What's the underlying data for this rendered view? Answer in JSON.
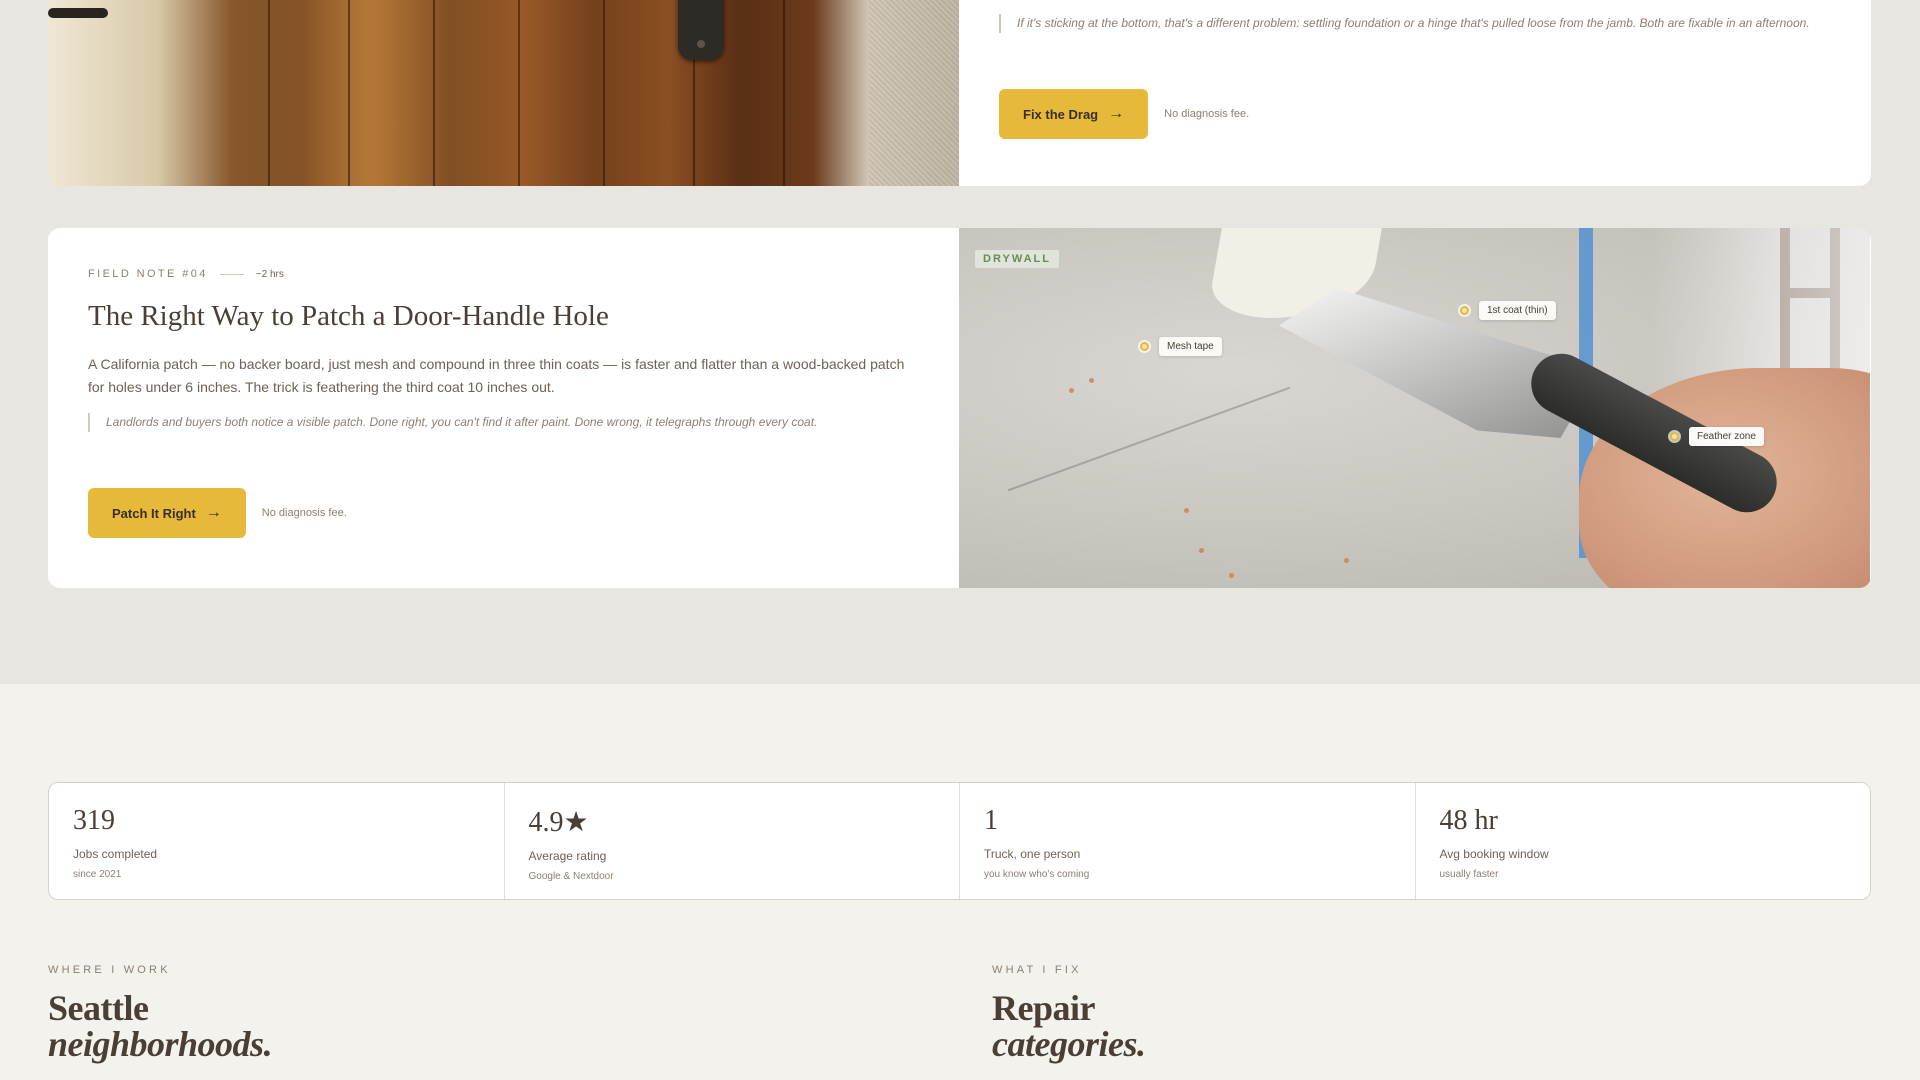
{
  "cards": {
    "drag": {
      "quote": "If it's sticking at the bottom, that's a different problem: settling foundation or a hinge that's pulled loose from the jamb. Both are fixable in an afternoon.",
      "button": "Fix the Drag",
      "note": "No diagnosis fee."
    },
    "patch": {
      "field_note": "FIELD NOTE #04",
      "duration": "~2 hrs",
      "title": "The Right Way to Patch a Door-Handle Hole",
      "body": "A California patch — no backer board, just mesh and compound in three thin coats — is faster and flatter than a wood-backed patch for holes under 6 inches. The trick is feathering the third coat 10 inches out.",
      "quote": "Landlords and buyers both notice a visible patch. Done right, you can't find it after paint. Done wrong, it telegraphs through every coat.",
      "button": "Patch It Right",
      "note": "No diagnosis fee.",
      "image_tag": "DRYWALL",
      "callouts": [
        "Mesh tape",
        "1st coat (thin)",
        "Feather zone"
      ]
    }
  },
  "stats": [
    {
      "value": "319",
      "label": "Jobs completed",
      "sub": "since 2021"
    },
    {
      "value": "4.9★",
      "label": "Average rating",
      "sub": "Google & Nextdoor"
    },
    {
      "value": "1",
      "label": "Truck, one person",
      "sub": "you know who's coming"
    },
    {
      "value": "48 hr",
      "label": "Avg booking window",
      "sub": "usually faster"
    }
  ],
  "where": {
    "eyebrow": "WHERE I WORK",
    "line1": "Seattle",
    "line2": "neighborhoods."
  },
  "what": {
    "eyebrow": "WHAT I FIX",
    "line1": "Repair",
    "line2": "categories."
  },
  "colors": {
    "accent": "#e6b93a",
    "page_bg": "#e8e6e1",
    "lower_bg": "#f4f2ed",
    "text": "#4a3f35"
  },
  "icons": {
    "button_arrow": "arrow-right-icon"
  }
}
